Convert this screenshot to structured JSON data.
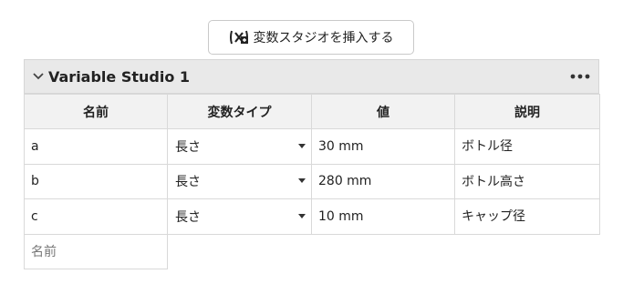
{
  "toolbar": {
    "insert_button_label": "変数スタジオを挿入する",
    "insert_icon": "variable-studio-icon"
  },
  "studio": {
    "title": "Variable Studio 1",
    "collapse_icon": "chevron-down-icon",
    "menu_icon": "more-horizontal-icon"
  },
  "table": {
    "headers": [
      "名前",
      "変数タイプ",
      "値",
      "説明"
    ],
    "rows": [
      {
        "name": "a",
        "type": "長さ",
        "value": "30 mm",
        "description": "ボトル径"
      },
      {
        "name": "b",
        "type": "長さ",
        "value": "280 mm",
        "description": "ボトル高さ"
      },
      {
        "name": "c",
        "type": "長さ",
        "value": "10 mm",
        "description": "キャップ径"
      }
    ],
    "new_row_placeholder": "名前"
  }
}
